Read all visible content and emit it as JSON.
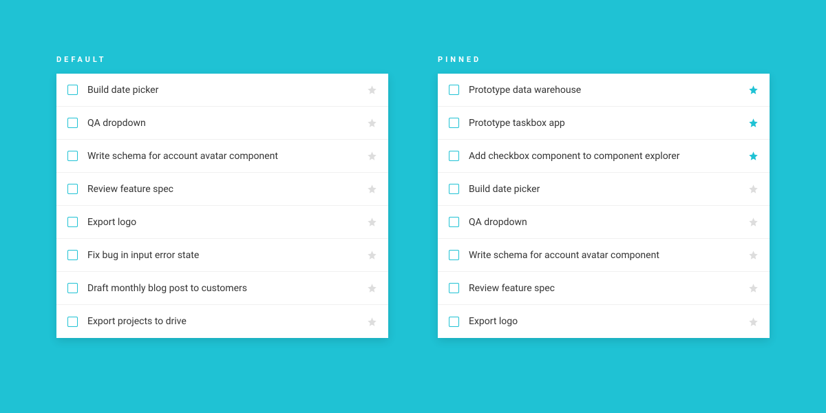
{
  "columns": [
    {
      "title": "DEFAULT",
      "items": [
        {
          "label": "Build date picker",
          "pinned": false
        },
        {
          "label": "QA dropdown",
          "pinned": false
        },
        {
          "label": "Write schema for account avatar component",
          "pinned": false
        },
        {
          "label": "Review feature spec",
          "pinned": false
        },
        {
          "label": "Export logo",
          "pinned": false
        },
        {
          "label": "Fix bug in input error state",
          "pinned": false
        },
        {
          "label": "Draft monthly blog post to customers",
          "pinned": false
        },
        {
          "label": "Export projects to drive",
          "pinned": false
        }
      ]
    },
    {
      "title": "PINNED",
      "items": [
        {
          "label": "Prototype data warehouse",
          "pinned": true
        },
        {
          "label": "Prototype taskbox app",
          "pinned": true
        },
        {
          "label": "Add checkbox component to component explorer",
          "pinned": true
        },
        {
          "label": "Build date picker",
          "pinned": false
        },
        {
          "label": "QA dropdown",
          "pinned": false
        },
        {
          "label": "Write schema for account avatar component",
          "pinned": false
        },
        {
          "label": "Review feature spec",
          "pinned": false
        },
        {
          "label": "Export logo",
          "pinned": false
        }
      ]
    }
  ],
  "colors": {
    "accent": "#1fc2d4",
    "star_inactive": "#dddddd"
  }
}
